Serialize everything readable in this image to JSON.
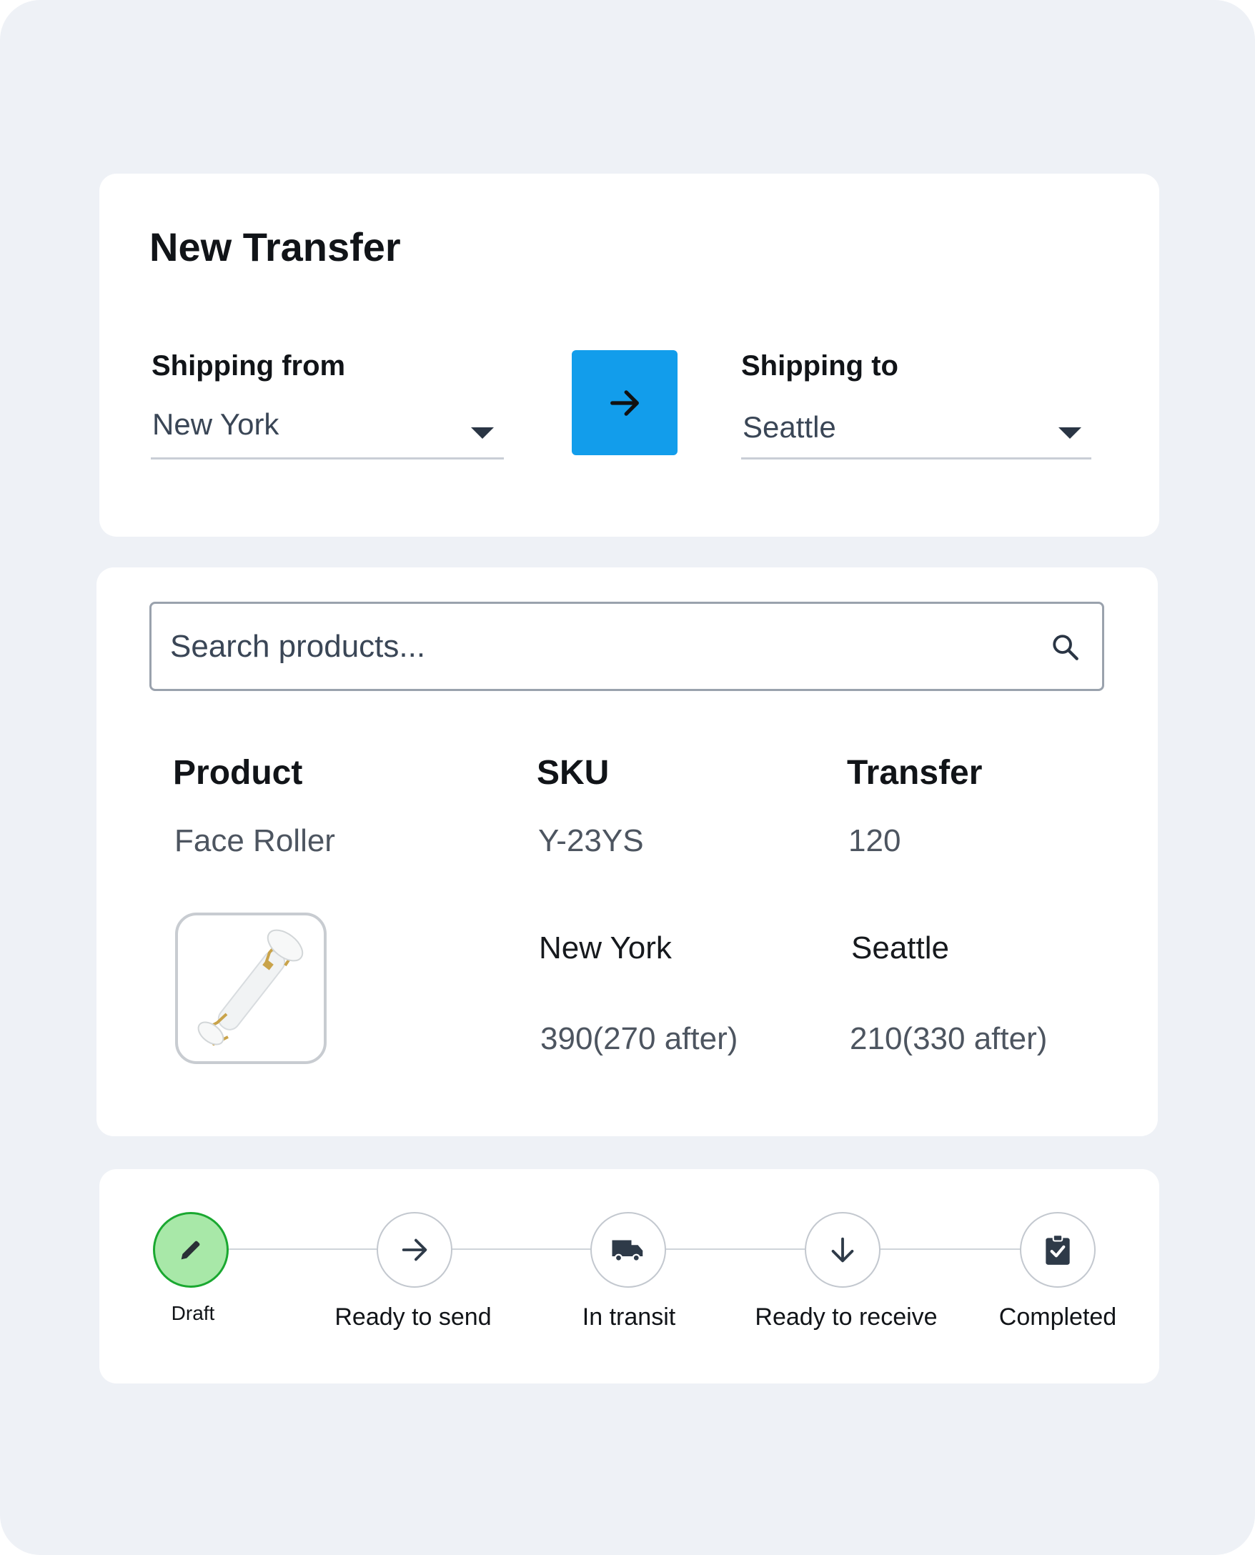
{
  "header": {
    "title": "New Transfer"
  },
  "shipping": {
    "from_label": "Shipping from",
    "from_value": "New York",
    "to_label": "Shipping to",
    "to_value": "Seattle",
    "swap_icon": "arrow-right-icon",
    "accent_color": "#129deb"
  },
  "search": {
    "placeholder": "Search products..."
  },
  "table": {
    "columns": [
      "Product",
      "SKU",
      "Transfer"
    ],
    "row": {
      "product": "Face Roller",
      "sku": "Y-23YS",
      "transfer": "120",
      "image": "face-roller-image",
      "from_location": "New York",
      "from_stock": "390(270 after)",
      "to_location": "Seattle",
      "to_stock": "210(330 after)"
    }
  },
  "status": {
    "active_color": "#1aa830",
    "steps": [
      {
        "label": "Draft",
        "icon": "pencil-icon",
        "active": true
      },
      {
        "label": "Ready to send",
        "icon": "arrow-right-icon",
        "active": false
      },
      {
        "label": "In transit",
        "icon": "truck-icon",
        "active": false
      },
      {
        "label": "Ready to receive",
        "icon": "arrow-down-icon",
        "active": false
      },
      {
        "label": "Completed",
        "icon": "clipboard-check-icon",
        "active": false
      }
    ]
  }
}
